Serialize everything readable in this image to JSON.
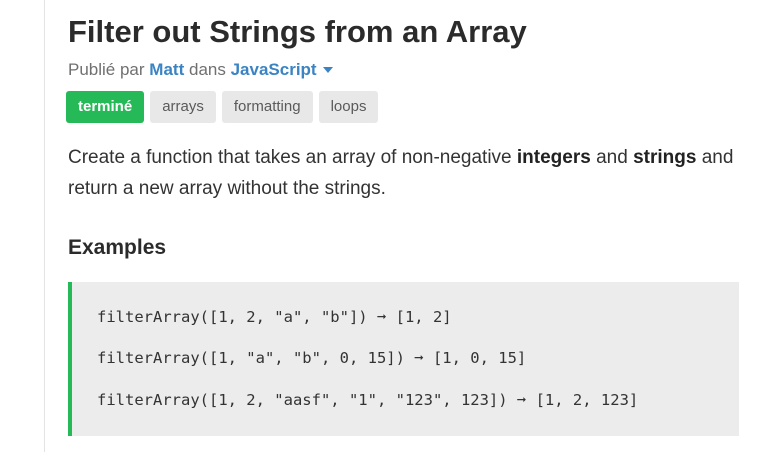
{
  "challenge": {
    "title": "Filter out Strings from an Array",
    "meta": {
      "published_by_label": "Publié par",
      "author": "Matt",
      "in_label": "dans",
      "language": "JavaScript"
    },
    "tags": [
      {
        "label": "terminé",
        "status": "done"
      },
      {
        "label": "arrays"
      },
      {
        "label": "formatting"
      },
      {
        "label": "loops"
      }
    ],
    "description": {
      "part1": "Create a function that takes an array of non-negative ",
      "bold1": "integers",
      "part2": " and ",
      "bold2": "strings",
      "part3": " and return a new array without the strings."
    },
    "examples_heading": "Examples",
    "examples": [
      "filterArray([1, 2, \"a\", \"b\"]) ➞ [1, 2]",
      "filterArray([1, \"a\", \"b\", 0, 15]) ➞ [1, 0, 15]",
      "filterArray([1, 2, \"aasf\", \"1\", \"123\", 123]) ➞ [1, 2, 123]"
    ]
  },
  "colors": {
    "accent_green": "#26b957",
    "link_blue": "#3b84c4",
    "tag_gray": "#e8e8e8",
    "code_bg": "#ececec"
  }
}
